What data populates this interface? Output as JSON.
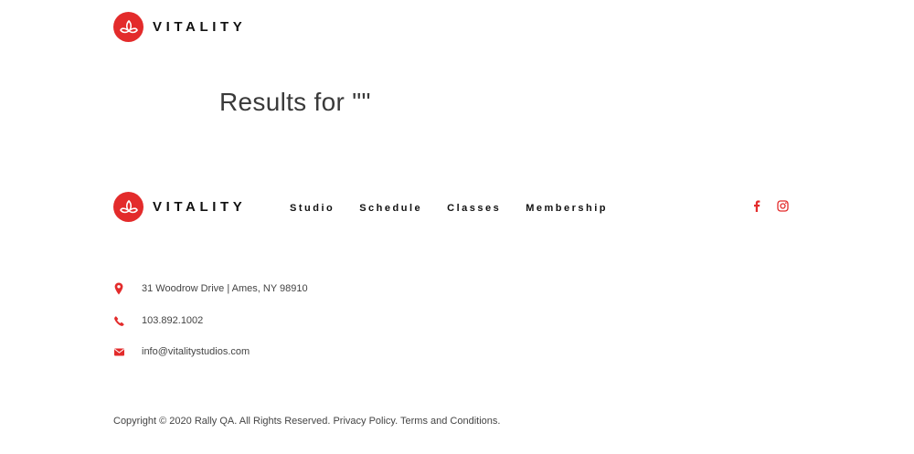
{
  "header": {
    "brand": "VITALITY"
  },
  "main": {
    "results_title": "Results for \"\""
  },
  "footer": {
    "brand": "VITALITY",
    "nav": [
      "Studio",
      "Schedule",
      "Classes",
      "Membership"
    ],
    "social": [
      "facebook-icon",
      "instagram-icon"
    ],
    "contact": {
      "address": "31 Woodrow Drive | Ames, NY 98910",
      "phone": "103.892.1002",
      "email": "info@vitalitystudios.com"
    },
    "copyright": {
      "text": "Copyright © 2020 Rally QA. All Rights Reserved.",
      "privacy": "Privacy Policy.",
      "terms": "Terms and Conditions."
    }
  },
  "colors": {
    "accent": "#e32b2b",
    "text": "#111111"
  }
}
